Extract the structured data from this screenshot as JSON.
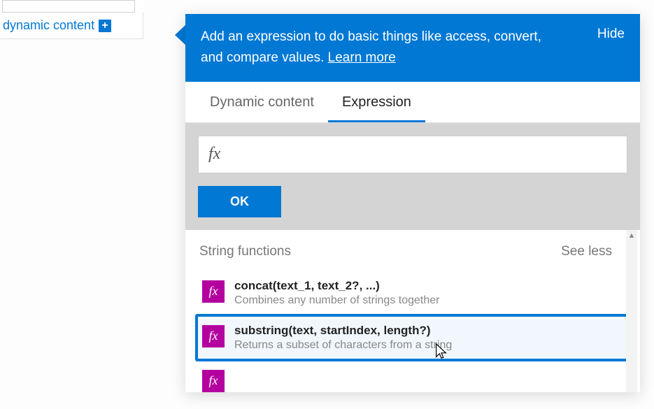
{
  "left": {
    "dynamic_content_label": "dynamic content"
  },
  "popout": {
    "header_text": "Add an expression to do basic things like access, convert, and compare values.",
    "learn_more": "Learn more",
    "hide": "Hide",
    "tabs": {
      "dynamic_content": "Dynamic content",
      "expression": "Expression"
    },
    "fx_symbol": "fx",
    "ok": "OK",
    "section": {
      "title": "String functions",
      "toggle": "See less"
    },
    "functions": [
      {
        "icon": "fx",
        "title": "concat(text_1, text_2?, ...)",
        "desc": "Combines any number of strings together",
        "selected": false
      },
      {
        "icon": "fx",
        "title": "substring(text, startIndex, length?)",
        "desc": "Returns a subset of characters from a string",
        "selected": true
      }
    ],
    "partial_fn_icon": "fx"
  }
}
